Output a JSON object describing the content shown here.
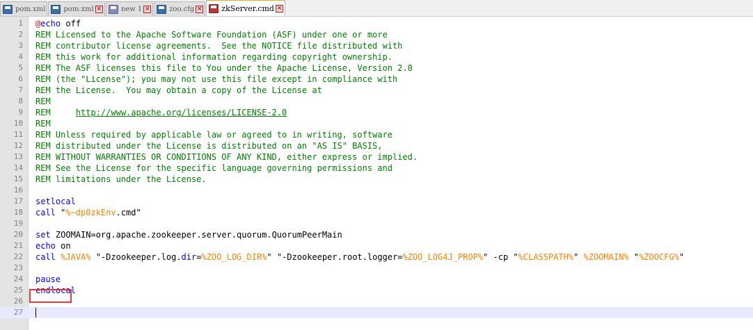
{
  "tabs": [
    {
      "label": "pom.xml",
      "icon": "save-file-icon",
      "active": false
    },
    {
      "label": "pom.xml",
      "icon": "save-file-icon",
      "active": false
    },
    {
      "label": "new 1",
      "icon": "plain-file-icon",
      "active": false
    },
    {
      "label": "zoo.cfg",
      "icon": "save-file-icon",
      "active": false
    },
    {
      "label": "zkServer.cmd",
      "icon": "modified-file-icon",
      "active": true
    }
  ],
  "editor": {
    "line_numbers": [
      "1",
      "2",
      "3",
      "4",
      "5",
      "6",
      "7",
      "8",
      "9",
      "10",
      "11",
      "12",
      "13",
      "14",
      "15",
      "16",
      "17",
      "18",
      "19",
      "20",
      "21",
      "22",
      "23",
      "24",
      "25",
      "26",
      "27"
    ],
    "lines": {
      "l1": {
        "at": "@",
        "cmd": "echo",
        "arg": " off"
      },
      "l2": "REM Licensed to the Apache Software Foundation (ASF) under one or more",
      "l3": "REM contributor license agreements.  See the NOTICE file distributed with",
      "l4": "REM this work for additional information regarding copyright ownership.",
      "l5": "REM The ASF licenses this file to You under the Apache License, Version 2.0",
      "l6": "REM (the \"License\"); you may not use this file except in compliance with",
      "l7": "REM the License.  You may obtain a copy of the License at",
      "l8": "REM",
      "l9": {
        "prefix": "REM     ",
        "url": "http://www.apache.org/licenses/LICENSE-2.0"
      },
      "l10": "REM",
      "l11": "REM Unless required by applicable law or agreed to in writing, software",
      "l12": "REM distributed under the License is distributed on an \"AS IS\" BASIS,",
      "l13": "REM WITHOUT WARRANTIES OR CONDITIONS OF ANY KIND, either express or implied.",
      "l14": "REM See the License for the specific language governing permissions and",
      "l15": "REM limitations under the License.",
      "l17": "setlocal",
      "l18": {
        "kw": "call",
        "q1": " \"",
        "var": "%~dp0zkEnv",
        "rest": ".cmd\""
      },
      "l20": {
        "kw": "set",
        "rest": " ZOOMAIN=org.apache.zookeeper.server.quorum.QuorumPeerMain"
      },
      "l21": {
        "kw": "echo",
        "rest": " on"
      },
      "l22": {
        "kw": "call",
        "sp": " ",
        "java": "%JAVA%",
        "opt1": " \"-Dzookeeper.log.",
        "dir": "dir",
        "eq1": "=",
        "logdir": "%ZOO_LOG_DIR%",
        "opt2": "\" \"-Dzookeeper.root.logger=",
        "log4j": "%ZOO_LOG4J_PROP%",
        "cp": "\" -cp \"",
        "classpath": "%CLASSPATH%",
        "q": "\" ",
        "zoomain": "%ZOOMAIN%",
        "q2": " \"",
        "zoocfg": "%ZOOCFG%",
        "end": "\""
      },
      "l24": "pause",
      "l25": "endlocal"
    }
  },
  "colors": {
    "comment": "#008000",
    "keyword": "#0000ff",
    "variable": "#ff8000",
    "highlight_box": "#e53935",
    "current_line": "#e8e8ff"
  }
}
